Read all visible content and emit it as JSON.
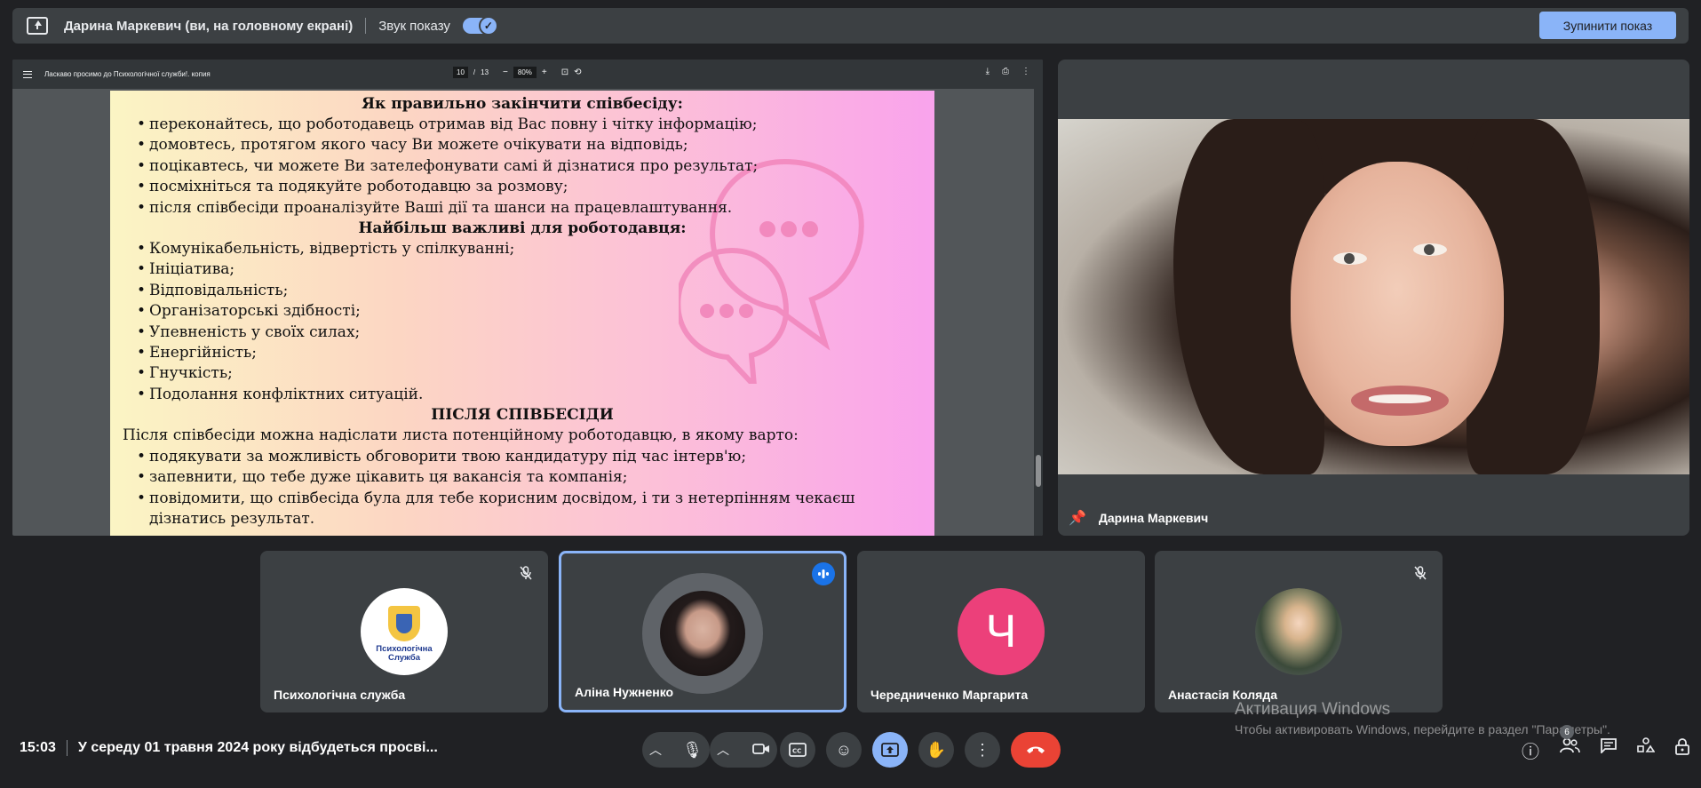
{
  "presenting_bar": {
    "title": "Дарина Маркевич (ви, на головному екрані)",
    "sound_label": "Звук показу",
    "sound_on": true,
    "stop_label": "Зупинити показ"
  },
  "pdf": {
    "title": "Ласкаво просимо до Психологічної служби!. копия",
    "page_current": "10",
    "page_sep": "/",
    "page_total": "13",
    "zoom": "80%",
    "page": {
      "heading1": "Як правильно закінчити співбесіду:",
      "list1": [
        "переконайтесь, що роботодавець отримав від Вас повну і чітку інформацію;",
        "домовтесь, протягом якого часу Ви можете очікувати на відповідь;",
        "поцікавтесь, чи можете Ви зателефонувати самі й дізнатися про результат;",
        "посміхніться та подякуйте роботодавцю за розмову;",
        "після співбесіди проаналізуйте Ваші дії та шанси на працевлаштування."
      ],
      "heading2": "Найбільш важливі для роботодавця:",
      "list2": [
        "Комунікабельність, відвертість у спілкуванні;",
        "Ініціатива;",
        "Відповідальність;",
        "Організаторські здібності;",
        "Упевненість у своїх силах;",
        "Енергійність;",
        "Гнучкість;",
        "Подолання конфліктних ситуацій."
      ],
      "heading3": "ПІСЛЯ СПІВБЕСІДИ",
      "paragraph": "Після співбесіди можна надіслати листа потенційному роботодавцю, в якому варто:",
      "list3": [
        "подякувати за можливість обговорити твою кандидатуру під час інтерв'ю;",
        "запевнити, що тебе дуже цікавить ця вакансія та компанія;",
        "повідомити, що співбесіда була для тебе корисним досвідом, і ти з нетерпінням чекаєш дізнатись результат."
      ]
    }
  },
  "speaker": {
    "name": "Дарина Маркевич"
  },
  "participants": [
    {
      "name": "Психологічна служба",
      "avatar": "logo",
      "logo_text": "Психологічна Служба",
      "muted": true,
      "speaking": false
    },
    {
      "name": "Аліна Нужненко",
      "avatar": "photo",
      "muted": false,
      "speaking": true
    },
    {
      "name": "Чередниченко Маргарита",
      "avatar": "letter",
      "letter": "Ч",
      "avatar_color": "#ec407a",
      "muted": false,
      "speaking": false
    },
    {
      "name": "Анастасія Коляда",
      "avatar": "photo",
      "muted": true,
      "speaking": false
    }
  ],
  "bottom": {
    "time": "15:03",
    "meeting_title": "У середу 01 травня 2024 року відбудеться просві...",
    "participants_count": "6"
  },
  "watermark": {
    "title": "Активация Windows",
    "subtitle": "Чтобы активировать Windows, перейдите в раздел \"Параметры\"."
  },
  "colors": {
    "background": "#202124",
    "surface": "#3c4043",
    "accent": "#8ab4f8",
    "end_call": "#ea4335",
    "active_border": "#8ab4f8"
  }
}
